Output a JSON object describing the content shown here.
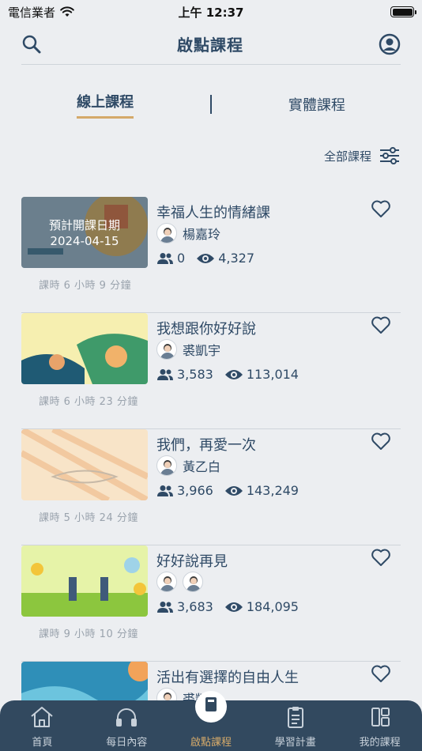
{
  "status": {
    "carrier": "電信業者",
    "time": "上午 12:37"
  },
  "header": {
    "title": "啟點課程"
  },
  "segments": {
    "online": "線上課程",
    "offline": "實體課程"
  },
  "filter": {
    "label": "全部課程"
  },
  "courses": [
    {
      "title": "幸福人生的情緒課",
      "authors": [
        "楊嘉玲"
      ],
      "members": "0",
      "views": "4,327",
      "duration": "課時 6 小時 9 分鐘",
      "overlay_line1": "預計開課日期",
      "overlay_line2": "2024-04-15",
      "thumb_text": "幸福人生的情緒課"
    },
    {
      "title": "我想跟你好好說",
      "authors": [
        "裘凱宇"
      ],
      "members": "3,583",
      "views": "113,014",
      "duration": "課時 6 小時 23 分鐘",
      "thumb_text": "我想跟你好好說"
    },
    {
      "title": "我們，再愛一次",
      "authors": [
        "黃乙白"
      ],
      "members": "3,966",
      "views": "143,249",
      "duration": "課時 5 小時 24 分鐘",
      "thumb_text": "我們，再愛一次"
    },
    {
      "title": "好好說再見",
      "authors": [
        "",
        ""
      ],
      "members": "3,683",
      "views": "184,095",
      "duration": "課時 9 小時 10 分鐘",
      "thumb_text": "好好說再見"
    },
    {
      "title": "活出有選擇的自由人生",
      "authors": [
        "裘凱宇"
      ],
      "members": "",
      "views": "",
      "duration": ""
    }
  ],
  "tabs": [
    {
      "label": "首頁",
      "icon": "home-icon"
    },
    {
      "label": "每日內容",
      "icon": "headphones-icon"
    },
    {
      "label": "啟點課程",
      "icon": "book-icon"
    },
    {
      "label": "學習計畫",
      "icon": "clipboard-icon"
    },
    {
      "label": "我的課程",
      "icon": "grid-icon"
    }
  ]
}
